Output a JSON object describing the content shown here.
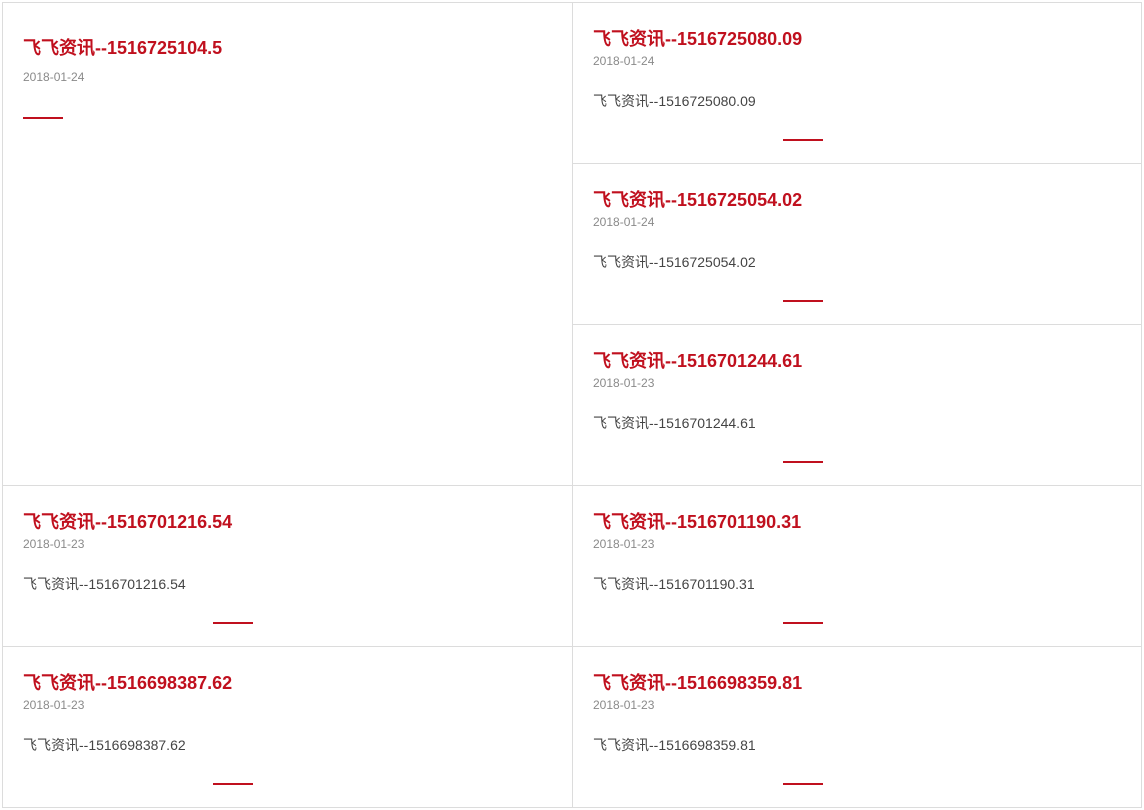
{
  "articles": [
    {
      "title": "飞飞资讯--1516725104.5",
      "date": "2018-01-24"
    },
    {
      "title": "飞飞资讯--1516725080.09",
      "date": "2018-01-24",
      "summary": "飞飞资讯--1516725080.09"
    },
    {
      "title": "飞飞资讯--1516725054.02",
      "date": "2018-01-24",
      "summary": "飞飞资讯--1516725054.02"
    },
    {
      "title": "飞飞资讯--1516701244.61",
      "date": "2018-01-23",
      "summary": "飞飞资讯--1516701244.61"
    },
    {
      "title": "飞飞资讯--1516701216.54",
      "date": "2018-01-23",
      "summary": "飞飞资讯--1516701216.54"
    },
    {
      "title": "飞飞资讯--1516701190.31",
      "date": "2018-01-23",
      "summary": "飞飞资讯--1516701190.31"
    },
    {
      "title": "飞飞资讯--1516698387.62",
      "date": "2018-01-23",
      "summary": "飞飞资讯--1516698387.62"
    },
    {
      "title": "飞飞资讯--1516698359.81",
      "date": "2018-01-23",
      "summary": "飞飞资讯--1516698359.81"
    }
  ],
  "colors": {
    "accent": "#c0101e",
    "border": "#dcdcdc",
    "date_text": "#8a8a8a",
    "body_text": "#444444"
  }
}
